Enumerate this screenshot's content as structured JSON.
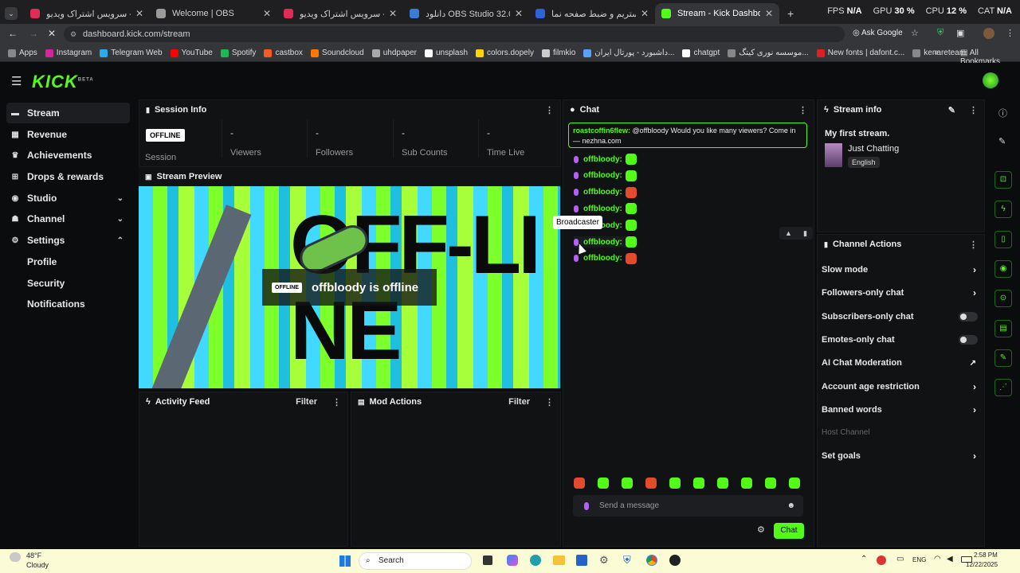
{
  "browser": {
    "tabs": [
      {
        "title": "آپارات - سرویس اشتراک ویدیو",
        "favicon_color": "#e22b56"
      },
      {
        "title": "Welcome | OBS",
        "favicon_color": "#9a9a9a"
      },
      {
        "title": "آپارات - سرویس اشتراک ویدیو",
        "favicon_color": "#e22b56"
      },
      {
        "title": "دانلود OBS Studio 32.0.4 Win/Mac",
        "favicon_color": "#3a7bd5"
      },
      {
        "title": "آموزش استریم و ضبط صفحه نما",
        "favicon_color": "#2b63d9"
      },
      {
        "title": "Stream - Kick Dashboard",
        "favicon_color": "#53fc18"
      }
    ],
    "system_stats": {
      "fps_label": "FPS",
      "fps": "N/A",
      "gpu_label": "GPU",
      "gpu": "30 %",
      "cpu_label": "CPU",
      "cpu": "12 %",
      "cat_label": "CAT",
      "cat": "N/A"
    },
    "url": "dashboard.kick.com/stream",
    "ask_google": "Ask Google",
    "bookmarks": [
      {
        "label": "Apps",
        "color": "#888888"
      },
      {
        "label": "Instagram",
        "color": "#d6249f"
      },
      {
        "label": "Telegram Web",
        "color": "#2aabee"
      },
      {
        "label": "YouTube",
        "color": "#ff0000"
      },
      {
        "label": "Spotify",
        "color": "#1db954"
      },
      {
        "label": "castbox",
        "color": "#f55b23"
      },
      {
        "label": "Soundcloud",
        "color": "#ff7700"
      },
      {
        "label": "uhdpaper",
        "color": "#aaaaaa"
      },
      {
        "label": "unsplash",
        "color": "#ffffff"
      },
      {
        "label": "colors.dopely",
        "color": "#ffd500"
      },
      {
        "label": "filmkio",
        "color": "#cccccc"
      },
      {
        "label": "داشبورد - پورتال ایران...",
        "color": "#5aa0ff"
      },
      {
        "label": "chatgpt",
        "color": "#ffffff"
      },
      {
        "label": "موسسه نوری کیتگ...",
        "color": "#888888"
      },
      {
        "label": "New fonts | dafont.c...",
        "color": "#e02020"
      },
      {
        "label": "kenareteam",
        "color": "#888888"
      }
    ],
    "all_bookmarks": "All Bookmarks"
  },
  "kick": {
    "logo": "KICK",
    "logo_tag": "BETA",
    "nav": [
      {
        "label": "Stream",
        "icon": "stream-icon"
      },
      {
        "label": "Revenue",
        "icon": "revenue-icon"
      },
      {
        "label": "Achievements",
        "icon": "trophy-icon"
      },
      {
        "label": "Drops & rewards",
        "icon": "gift-icon"
      },
      {
        "label": "Studio",
        "icon": "studio-icon"
      },
      {
        "label": "Channel",
        "icon": "channel-icon"
      },
      {
        "label": "Settings",
        "icon": "gear-icon"
      }
    ],
    "settings_sub": [
      "Profile",
      "Security",
      "Notifications"
    ],
    "session_info": {
      "title": "Session Info",
      "status_badge": "OFFLINE",
      "stats": [
        {
          "value": "",
          "label": "Session"
        },
        {
          "value": "-",
          "label": "Viewers"
        },
        {
          "value": "-",
          "label": "Followers"
        },
        {
          "value": "-",
          "label": "Sub Counts"
        },
        {
          "value": "-",
          "label": "Time Live"
        }
      ]
    },
    "preview": {
      "title": "Stream Preview",
      "badge": "OFFLINE",
      "message": "offbloody is offline",
      "background_text": "OFF-LINE"
    },
    "activity_feed": {
      "title": "Activity Feed",
      "filter": "Filter"
    },
    "mod_actions": {
      "title": "Mod Actions",
      "filter": "Filter"
    },
    "chat": {
      "title": "Chat",
      "pinned_user": "roastcoffin6flew:",
      "pinned_text": "@offbloody Would you like many viewers? Come in — nezhna.com",
      "messages": [
        {
          "user": "offbloody:",
          "emote": "green"
        },
        {
          "user": "offbloody:",
          "emote": "green"
        },
        {
          "user": "offbloody:",
          "emote": "red"
        },
        {
          "user": "offbloody:",
          "emote": "green"
        },
        {
          "user": "offbloody:",
          "emote": "green"
        },
        {
          "user": "offbloody:",
          "emote": "green"
        },
        {
          "user": "offbloody:",
          "emote": "red"
        }
      ],
      "tooltip": "Broadcaster",
      "input_placeholder": "Send a message",
      "send_label": "Chat"
    },
    "stream_info": {
      "title": "Stream info",
      "stream_title": "My first stream.",
      "category": "Just Chatting",
      "language": "English"
    },
    "channel_actions": {
      "title": "Channel Actions",
      "items": [
        {
          "label": "Slow mode",
          "kind": "chevron"
        },
        {
          "label": "Followers-only chat",
          "kind": "chevron"
        },
        {
          "label": "Subscribers-only chat",
          "kind": "toggle"
        },
        {
          "label": "Emotes-only chat",
          "kind": "toggle"
        },
        {
          "label": "AI Chat Moderation",
          "kind": "external"
        },
        {
          "label": "Account age restriction",
          "kind": "chevron"
        },
        {
          "label": "Banned words",
          "kind": "chevron"
        },
        {
          "label": "Host Channel",
          "kind": "disabled"
        },
        {
          "label": "Set goals",
          "kind": "chevron"
        }
      ]
    }
  },
  "taskbar": {
    "weather_temp": "48°F",
    "weather_desc": "Cloudy",
    "search": "Search",
    "time": "2:58 PM",
    "date": "12/22/2025",
    "lang": "ENG"
  }
}
